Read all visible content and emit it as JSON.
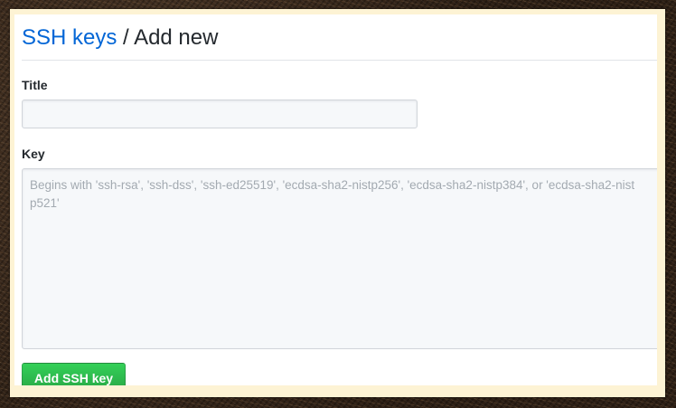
{
  "breadcrumb": {
    "parent_link": "SSH keys",
    "separator": " / ",
    "current": "Add new"
  },
  "form": {
    "title_label": "Title",
    "title_value": "",
    "key_label": "Key",
    "key_placeholder": "Begins with 'ssh-rsa', 'ssh-dss', 'ssh-ed25519', 'ecdsa-sha2-nistp256', 'ecdsa-sha2-nistp384', or 'ecdsa-sha2-nistp521'",
    "submit_label": "Add SSH key"
  },
  "colors": {
    "link": "#0366d6",
    "button": "#28a745",
    "border_frame": "#fdf3d4"
  }
}
